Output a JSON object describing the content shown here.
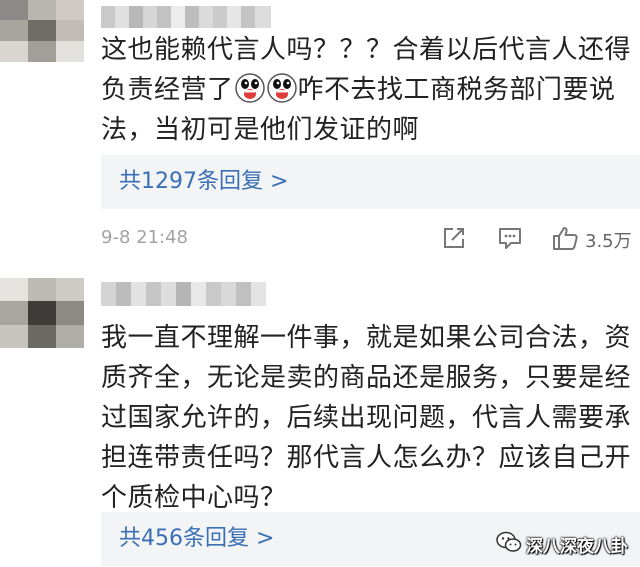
{
  "comments": [
    {
      "text_parts": [
        "这也能赖代言人吗？？？合着以后代言人还得负责经营了",
        "咋不去找工商税务部门要说法，当初可是他们发证的啊"
      ],
      "emoji_icons": [
        "grimace-emoji-icon",
        "grimace-emoji-icon"
      ],
      "reply_label": "共1297条回复 >",
      "timestamp": "9-8 21:48",
      "like_count": "3.5万"
    },
    {
      "text": "我一直不理解一件事，就是如果公司合法，资质齐全，无论是卖的商品还是服务，只要是经过国家允许的，后续出现问题，代言人需要承担连带责任吗？那代言人怎么办？应该自己开个质检中心吗？",
      "reply_label": "共456条回复 >"
    }
  ],
  "watermark": {
    "text": "深八深夜八卦",
    "icon": "wechat-icon"
  },
  "colors": {
    "text": "#222222",
    "link": "#3a6fb5",
    "reply_bg": "#f3f4f6",
    "meta": "#a3a3a3"
  }
}
